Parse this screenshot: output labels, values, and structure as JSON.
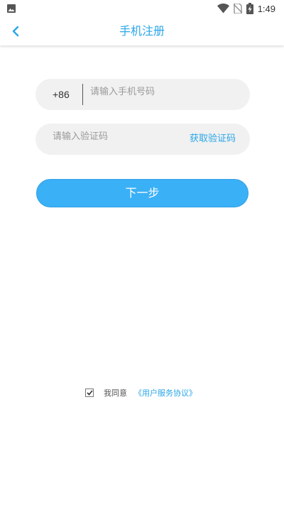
{
  "status_bar": {
    "time": "1:49",
    "icons": [
      "image-icon",
      "wifi-icon",
      "no-sim-icon",
      "battery-charging-icon"
    ]
  },
  "header": {
    "back_icon": "chevron-left-icon",
    "title": "手机注册"
  },
  "form": {
    "phone": {
      "country_code": "+86",
      "placeholder": "请输入手机号码",
      "value": ""
    },
    "code": {
      "placeholder": "请输入验证码",
      "value": "",
      "get_code_label": "获取验证码"
    },
    "next_label": "下一步"
  },
  "agreement": {
    "checked": true,
    "prefix": "我同意",
    "link_text": "《用户服务协议》"
  },
  "colors": {
    "accent": "#2aa6e8",
    "button": "#3ab0f6",
    "field_bg": "#f1f1f1"
  }
}
